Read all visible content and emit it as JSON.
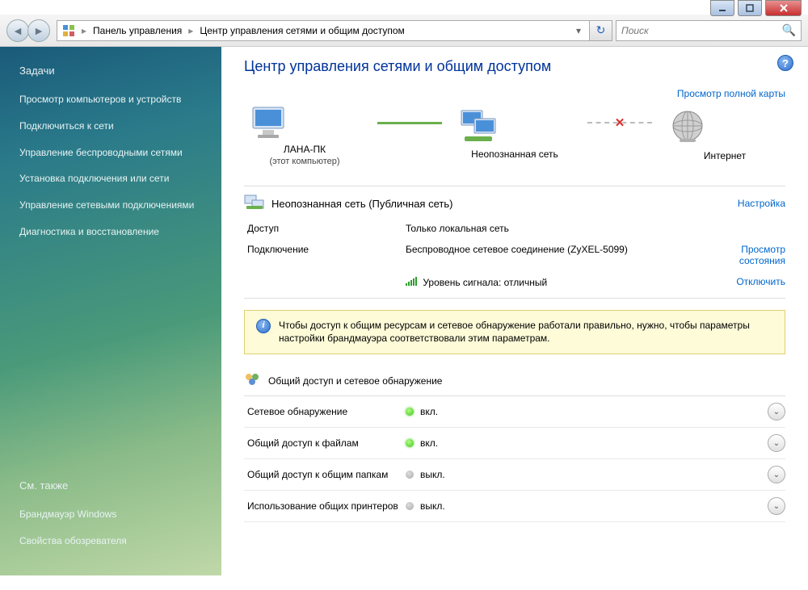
{
  "window": {
    "breadcrumb": [
      "Панель управления",
      "Центр управления сетями и общим доступом"
    ],
    "search_placeholder": "Поиск"
  },
  "sidebar": {
    "tasks_heading": "Задачи",
    "items": [
      "Просмотр компьютеров и устройств",
      "Подключиться к сети",
      "Управление беспроводными сетями",
      "Установка подключения или сети",
      "Управление сетевыми подключениями",
      "Диагностика и восстановление"
    ],
    "seealso_heading": "См. также",
    "seealso": [
      "Брандмауэр Windows",
      "Свойства обозревателя"
    ]
  },
  "main": {
    "title": "Центр управления сетями и общим доступом",
    "view_full_map": "Просмотр полной карты",
    "nodes": {
      "pc_name": "ЛАНА-ПК",
      "pc_sub": "(этот компьютер)",
      "network": "Неопознанная сеть",
      "internet": "Интернет"
    },
    "network_section": {
      "title": "Неопознанная сеть (Публичная сеть)",
      "customize": "Настройка",
      "access_label": "Доступ",
      "access_value": "Только локальная сеть",
      "connection_label": "Подключение",
      "connection_value": "Беспроводное сетевое соединение (ZyXEL-5099)",
      "view_status": "Просмотр состояния",
      "signal_label": "Уровень сигнала: отличный",
      "disconnect": "Отключить"
    },
    "info_banner": "Чтобы доступ к общим ресурсам и сетевое обнаружение работали правильно, нужно, чтобы параметры настройки брандмауэра соответствовали этим параметрам.",
    "sharing": {
      "heading": "Общий доступ и сетевое обнаружение",
      "on": "вкл.",
      "off": "выкл.",
      "rows": [
        {
          "label": "Сетевое обнаружение",
          "state": "on"
        },
        {
          "label": "Общий доступ к файлам",
          "state": "on"
        },
        {
          "label": "Общий доступ к общим папкам",
          "state": "off"
        },
        {
          "label": "Использование общих принтеров",
          "state": "off"
        }
      ]
    }
  }
}
